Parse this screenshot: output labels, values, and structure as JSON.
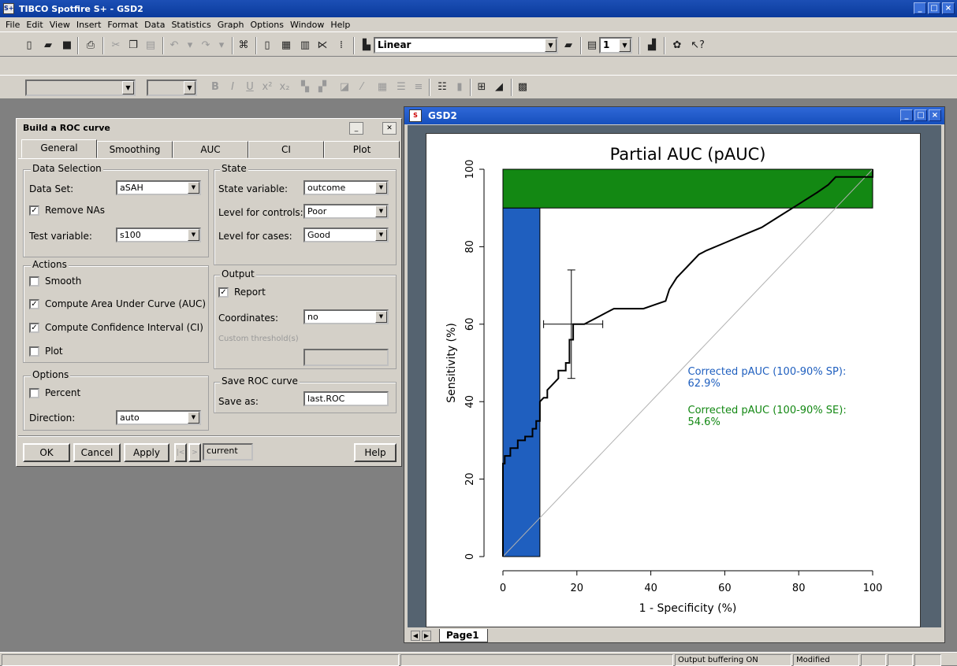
{
  "app": {
    "title": "TIBCO Spotfire S+ - GSD2",
    "icon_text": "S+",
    "menu": [
      "File",
      "Edit",
      "View",
      "Insert",
      "Format",
      "Data",
      "Statistics",
      "Graph",
      "Options",
      "Window",
      "Help"
    ],
    "toolbar": {
      "plot_type_value": "Linear",
      "page_count_value": "1"
    },
    "status": {
      "output_buffering": "Output buffering ON",
      "modified": "Modified"
    }
  },
  "dialog": {
    "title": "Build a ROC curve",
    "tabs": [
      "General",
      "Smoothing",
      "AUC",
      "CI",
      "Plot"
    ],
    "data_selection": {
      "group_title": "Data Selection",
      "data_set_label": "Data Set:",
      "data_set_value": "aSAH",
      "remove_nas_label": "Remove NAs",
      "remove_nas_checked": true,
      "test_variable_label": "Test variable:",
      "test_variable_value": "s100"
    },
    "state": {
      "group_title": "State",
      "state_variable_label": "State variable:",
      "state_variable_value": "outcome",
      "level_controls_label": "Level for controls:",
      "level_controls_value": "Poor",
      "level_cases_label": "Level for cases:",
      "level_cases_value": "Good"
    },
    "actions": {
      "group_title": "Actions",
      "smooth_label": "Smooth",
      "smooth_checked": false,
      "auc_label": "Compute Area Under Curve (AUC)",
      "auc_checked": true,
      "ci_label": "Compute Confidence Interval (CI)",
      "ci_checked": true,
      "plot_label": "Plot",
      "plot_checked": false
    },
    "output": {
      "group_title": "Output",
      "report_label": "Report",
      "report_checked": true,
      "coordinates_label": "Coordinates:",
      "coordinates_value": "no",
      "custom_threshold_label": "Custom threshold(s)"
    },
    "options": {
      "group_title": "Options",
      "percent_label": "Percent",
      "percent_checked": false,
      "direction_label": "Direction:",
      "direction_value": "auto"
    },
    "save": {
      "group_title": "Save ROC curve",
      "save_as_label": "Save as:",
      "save_as_value": "last.ROC"
    },
    "buttons": {
      "ok": "OK",
      "cancel": "Cancel",
      "apply": "Apply",
      "current": "current",
      "help": "Help"
    }
  },
  "graph_window": {
    "title": "GSD2",
    "page_tab": "Page1"
  },
  "chart_data": {
    "type": "line",
    "title": "Partial AUC (pAUC)",
    "xlabel": "1 - Specificity (%)",
    "ylabel": "Sensitivity (%)",
    "xlim": [
      0,
      100
    ],
    "ylim": [
      0,
      100
    ],
    "x_ticks": [
      "0",
      "20",
      "40",
      "60",
      "80",
      "100"
    ],
    "y_ticks": [
      "0",
      "20",
      "40",
      "60",
      "80",
      "100"
    ],
    "grid": false,
    "colors": {
      "sp_region": "#1f5fbf",
      "se_region": "#138813",
      "curve": "#000000",
      "diagonal": "#b0b0b0"
    },
    "sp_region": {
      "x": [
        0,
        10
      ],
      "y": [
        0,
        90
      ]
    },
    "se_region": {
      "x": [
        0,
        100
      ],
      "y": [
        90,
        100
      ]
    },
    "roc_curve": {
      "x": [
        0,
        0,
        0.5,
        0.5,
        2,
        2,
        4,
        4,
        6,
        6,
        8,
        8,
        9,
        9,
        10,
        10,
        11,
        12,
        12,
        14,
        15,
        15,
        17,
        17,
        18,
        18,
        19,
        19,
        22,
        24,
        26,
        28,
        30,
        36,
        38,
        41,
        44,
        45,
        47,
        48,
        50,
        53,
        55,
        60,
        65,
        70,
        75,
        80,
        85,
        88,
        90,
        93,
        96,
        100,
        100
      ],
      "y": [
        0,
        24,
        24,
        26,
        26,
        28,
        28,
        30,
        30,
        31,
        31,
        33,
        33,
        35,
        35,
        40,
        41,
        41,
        43,
        45,
        46,
        48,
        48,
        50,
        50,
        56,
        56,
        60,
        60,
        61,
        62,
        63,
        64,
        64,
        64,
        65,
        66,
        69,
        72,
        73,
        75,
        78,
        79,
        81,
        83,
        85,
        88,
        91,
        94,
        96,
        98,
        98,
        98,
        98,
        100
      ]
    },
    "ci_cross": {
      "x": 18.5,
      "y": 60,
      "x_range": [
        11,
        27
      ],
      "y_range": [
        46,
        74
      ]
    },
    "annotations": [
      {
        "text_1": "Corrected pAUC (100-90% SP):",
        "text_2": "62.9%",
        "color": "#1f5fbf"
      },
      {
        "text_1": "Corrected pAUC (100-90% SE):",
        "text_2": "54.6%",
        "color": "#138813"
      }
    ]
  }
}
